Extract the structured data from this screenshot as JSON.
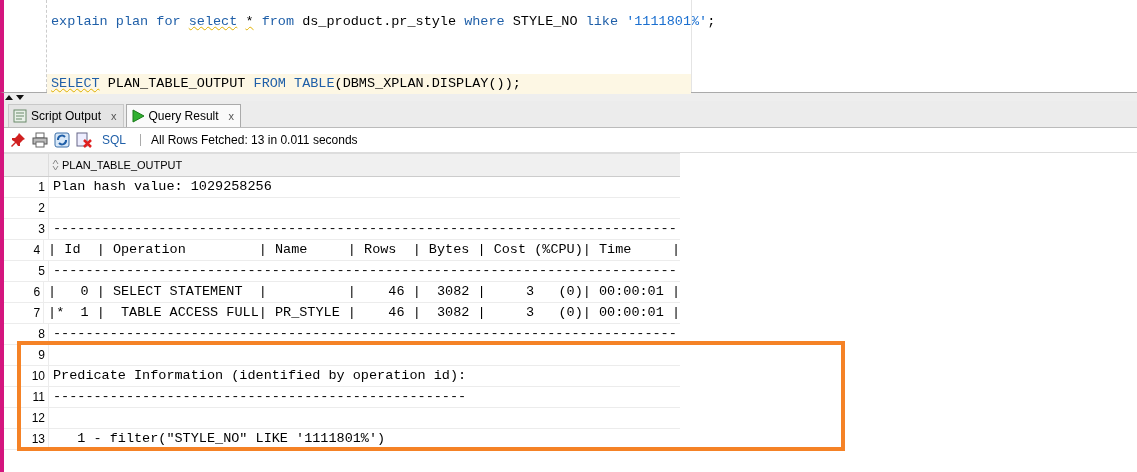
{
  "editor": {
    "lines": [
      {
        "current": false,
        "tokens": [
          {
            "kind": "keyword",
            "text": "explain plan for"
          },
          {
            "kind": "keyword",
            "text": "select",
            "squiggle": true
          },
          {
            "kind": "plain",
            "text": "*",
            "squiggle": true
          },
          {
            "kind": "keyword",
            "text": "from"
          },
          {
            "kind": "plain",
            "text": "ds_product.pr_style"
          },
          {
            "kind": "keyword",
            "text": "where"
          },
          {
            "kind": "plain",
            "text": "STYLE_NO"
          },
          {
            "kind": "keyword",
            "text": "like"
          },
          {
            "kind": "string",
            "text": "'1111801%'",
            "suffix": ";"
          }
        ]
      },
      {
        "current": true,
        "tokens": [
          {
            "kind": "keyword",
            "text": "SELECT",
            "squiggle": true
          },
          {
            "kind": "plain",
            "text": "PLAN_TABLE_OUTPUT"
          },
          {
            "kind": "keyword",
            "text": "FROM"
          },
          {
            "kind": "keyword",
            "text": "TABLE"
          },
          {
            "kind": "plain",
            "text": "(DBMS_XPLAN.DISPLAY());",
            "attach": true
          }
        ]
      }
    ]
  },
  "tabs": [
    {
      "label": "Script Output",
      "close": "x",
      "selected": false
    },
    {
      "label": "Query Result",
      "close": "x",
      "selected": true
    }
  ],
  "toolbar": {
    "sql_link": "SQL",
    "status": "All Rows Fetched: 13 in 0.011 seconds"
  },
  "grid": {
    "column": "PLAN_TABLE_OUTPUT",
    "rows": [
      {
        "number": "1",
        "text": "Plan hash value: 1029258256"
      },
      {
        "number": "2"
      },
      {
        "number": "3",
        "text": "-----------------------------------------------------------------------------"
      },
      {
        "number": "4",
        "text": "| Id  | Operation         | Name     | Rows  | Bytes | Cost (%CPU)| Time     |"
      },
      {
        "number": "5",
        "text": "-----------------------------------------------------------------------------"
      },
      {
        "number": "6",
        "text": "|   0 | SELECT STATEMENT  |          |    46 |  3082 |     3   (0)| 00:00:01 |"
      },
      {
        "number": "7",
        "text": "|*  1 |  TABLE ACCESS FULL| PR_STYLE |    46 |  3082 |     3   (0)| 00:00:01 |"
      },
      {
        "number": "8",
        "text": "-----------------------------------------------------------------------------"
      },
      {
        "number": "9"
      },
      {
        "number": "10",
        "text": "Predicate Information (identified by operation id):"
      },
      {
        "number": "11",
        "text": "---------------------------------------------------"
      },
      {
        "number": "12"
      },
      {
        "number": "13",
        "text": "   1 - filter(\"STYLE_NO\" LIKE '1111801%')"
      }
    ]
  }
}
